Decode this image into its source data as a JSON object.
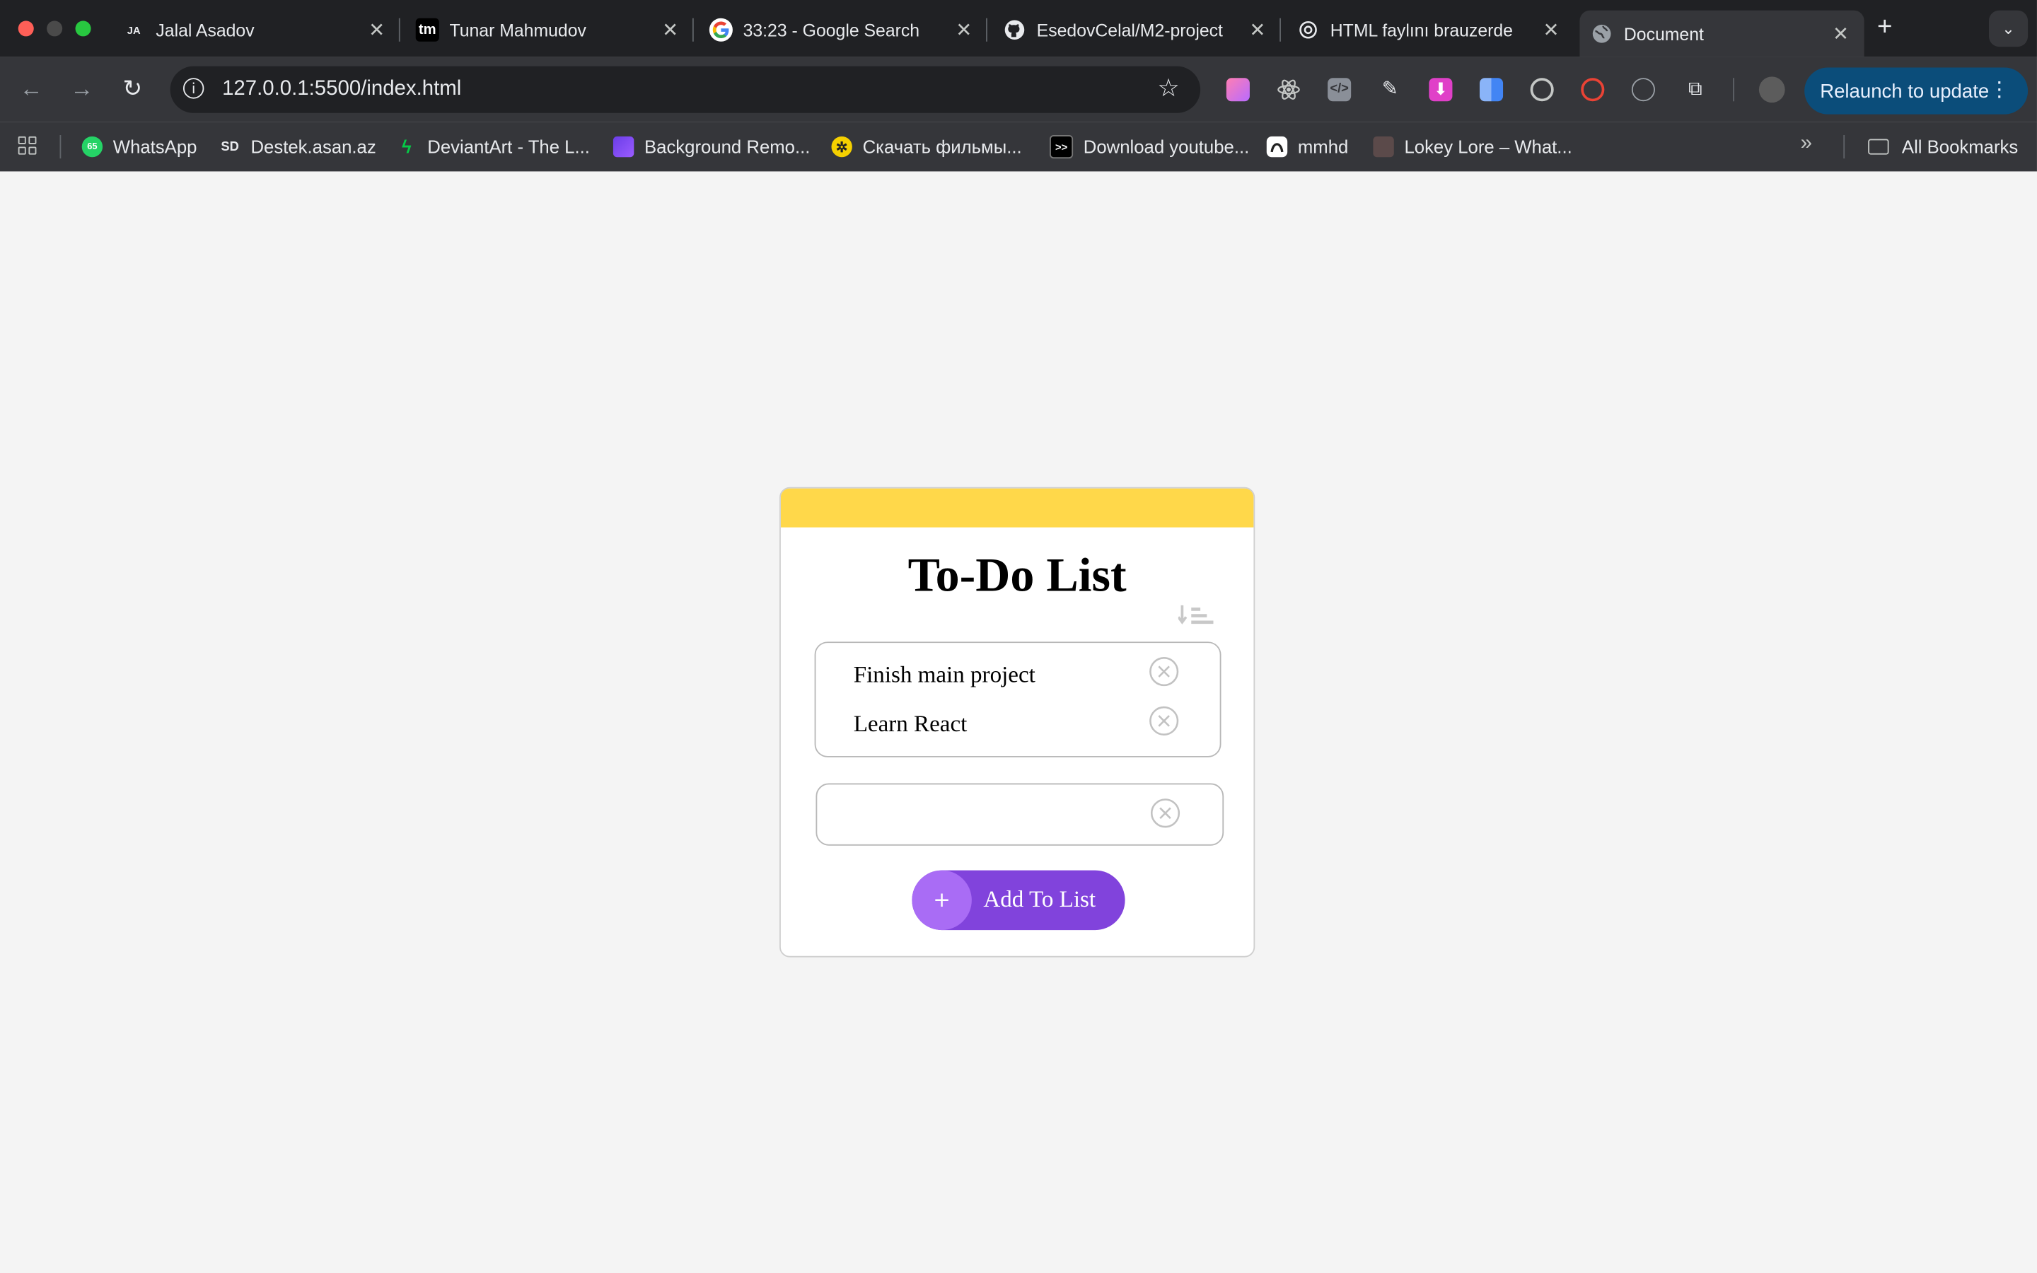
{
  "browser": {
    "tabs": [
      {
        "title": "Jalal Asadov",
        "favicon": "jalal-favicon",
        "active": false
      },
      {
        "title": "Tunar Mahmudov",
        "favicon": "tm-favicon",
        "active": false
      },
      {
        "title": "33:23 - Google Search",
        "favicon": "google-favicon",
        "active": false
      },
      {
        "title": "EsedovCelal/M2-project",
        "favicon": "github-favicon",
        "active": false
      },
      {
        "title": "HTML faylını brauzerde",
        "favicon": "chatgpt-favicon",
        "active": false
      },
      {
        "title": "Document",
        "favicon": "globe-favicon",
        "active": true
      }
    ],
    "favicon_text": {
      "jalal": "JA",
      "tm": "tm"
    },
    "address": "127.0.0.1:5500/index.html",
    "relaunch_label": "Relaunch to update",
    "bookmarks": [
      {
        "label": "WhatsApp",
        "icon": "whatsapp-icon",
        "badge": "65"
      },
      {
        "label": "Destek.asan.az",
        "icon": "sd-icon",
        "badge": "SD"
      },
      {
        "label": "DeviantArt - The L...",
        "icon": "deviantart-icon"
      },
      {
        "label": "Background Remo...",
        "icon": "background-remover-icon"
      },
      {
        "label": "Скачать фильмы...",
        "icon": "film-reel-icon"
      },
      {
        "label": "Download youtube...",
        "icon": "terminal-icon",
        "badge": ">>"
      },
      {
        "label": "mmhd",
        "icon": "mmhd-icon"
      },
      {
        "label": "Lokey Lore – What...",
        "icon": "lokey-icon"
      }
    ],
    "all_bookmarks_label": "All Bookmarks",
    "colors": {
      "tab_strip": "#202124",
      "toolbar": "#35363a",
      "relaunch_bg": "#0b4d7a"
    }
  },
  "todo": {
    "title": "To-Do List",
    "items": [
      {
        "text": "Finish main project"
      },
      {
        "text": "Learn React"
      }
    ],
    "input": {
      "value": "",
      "placeholder": ""
    },
    "add_button_label": "Add To List",
    "add_button_icon": "+",
    "colors": {
      "header_strip": "#ffd84a",
      "button": "#8143dc",
      "button_icon_bg": "#a96cf5",
      "page_bg": "#f4f4f4"
    }
  }
}
